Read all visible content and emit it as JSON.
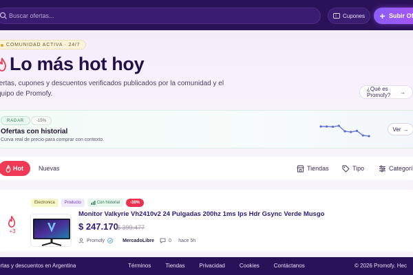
{
  "topbar": {
    "search_placeholder": "Buscar ofertas...",
    "coupons_label": "Cupones",
    "upload_label": "Subir Ofe"
  },
  "hero": {
    "badge": "COMUNIDAD ACTIVA · 24/7",
    "title": "Lo más hot hoy",
    "subtitle_line1": "fertas, cupones y descuentos verificados publicados por la comunidad y el",
    "subtitle_line2": "quipo de Promofy.",
    "what_is_label": "¿Qué es Promofy?"
  },
  "radar": {
    "tag": "RADAR",
    "pct": "-15%",
    "title": "Ofertas con historial",
    "subtitle": "Curva real de precio para comprar con contexto.",
    "ver_label": "Ver",
    "sparkline": [
      0.2,
      0.2,
      0.22,
      0.15,
      0.55,
      0.6,
      0.52,
      0.85,
      0.9
    ],
    "colors": {
      "line": "#6a7bd8",
      "dot": "#5b6cd1"
    }
  },
  "filters": {
    "hot_label": "Hot",
    "nuevas_label": "Nuevas",
    "tiendas_label": "Tiendas",
    "tipo_label": "Tipo",
    "categorias_label": "Categorías"
  },
  "deal": {
    "chips": {
      "category": "Electronica",
      "type": "Producto",
      "history": "Con historial",
      "discount": "-38%"
    },
    "votes": "+3",
    "title": "Monitor Valkyrie Vh2410v2 24 Pulgadas 200hz 1ms Ips Hdr Gsync Verde Musgo",
    "price": "$ 247.170",
    "old_price": "$ 399.477",
    "author": "Promofy",
    "store": "MercadoLibre",
    "comments": "0",
    "time": "hace 5h"
  },
  "footer": {
    "left": "ertas y descuentos en Argentina",
    "links": [
      "Términos",
      "Tiendas",
      "Privacidad",
      "Cookies",
      "Contáctanos"
    ],
    "right": "© 2026 Promofy. Hec"
  },
  "colors": {
    "topbar": "#2a1258",
    "accent": "#a855f7",
    "hot": "#ee3a55",
    "title": "#241048"
  }
}
